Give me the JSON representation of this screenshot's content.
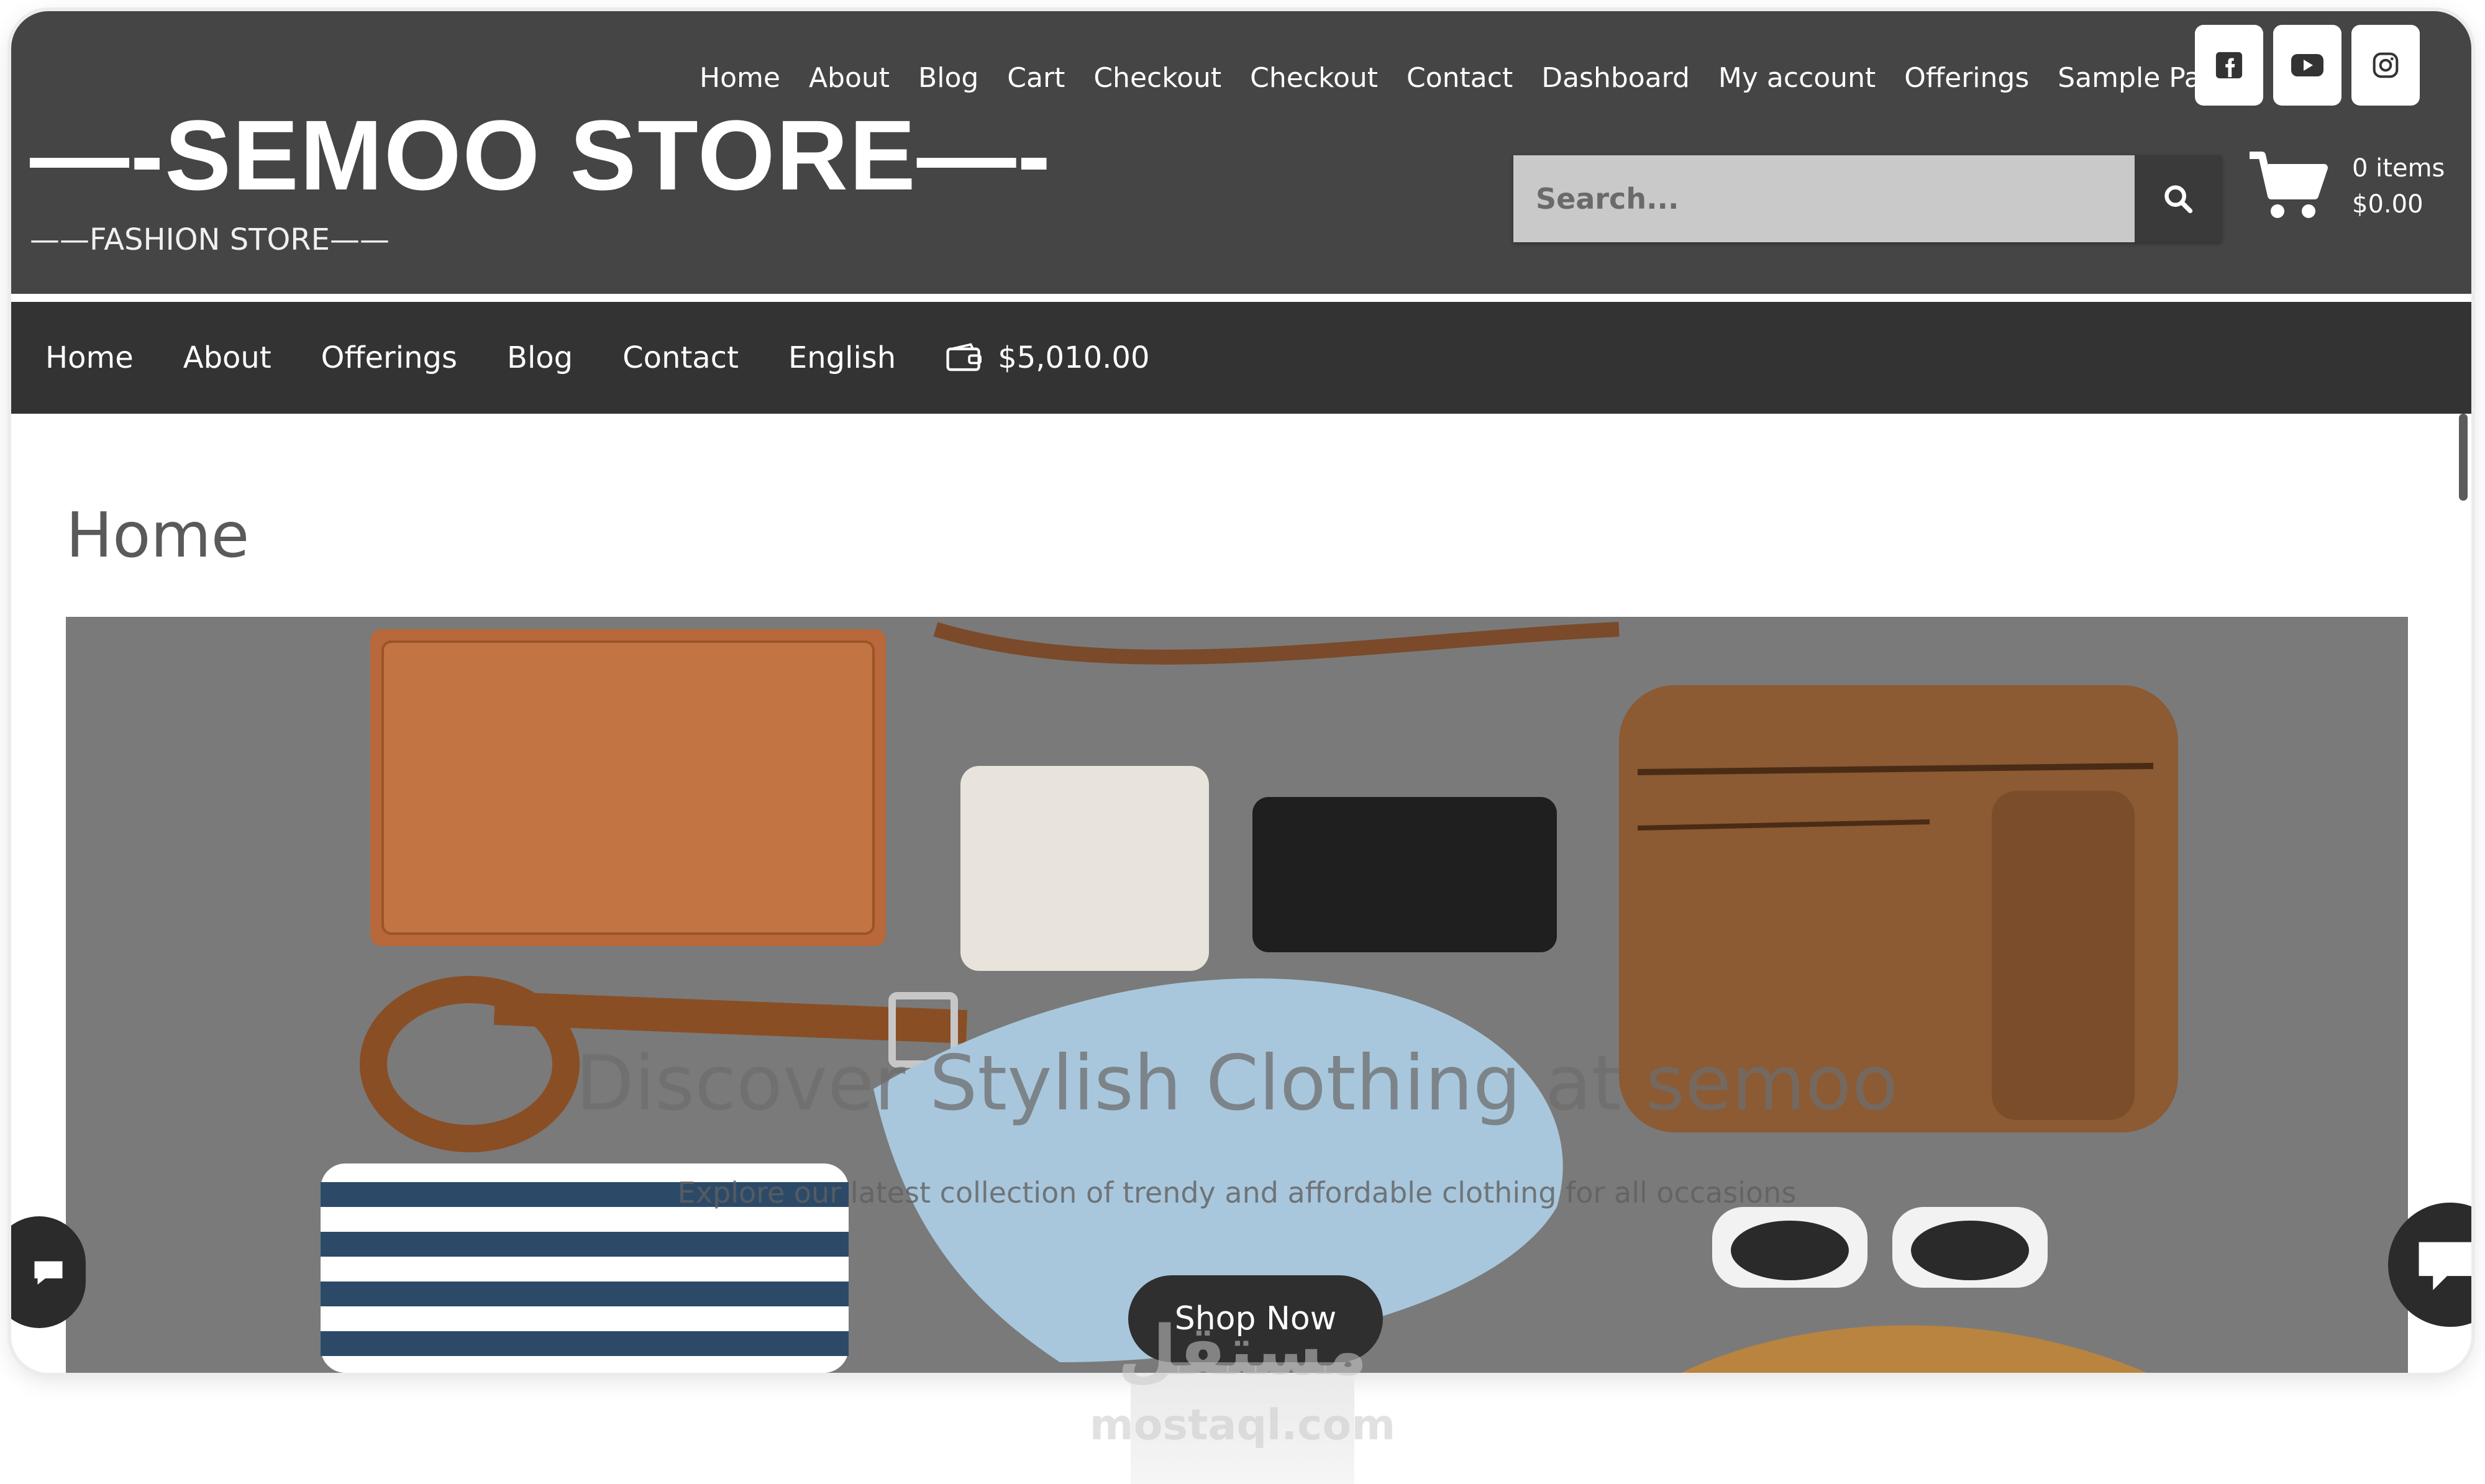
{
  "header": {
    "top_nav": [
      "Home",
      "About",
      "Blog",
      "Cart",
      "Checkout",
      "Checkout",
      "Contact",
      "Dashboard",
      "My account",
      "Offerings",
      "Sample Page"
    ],
    "site_title": "—-SEMOO STORE—-",
    "tagline": "——FASHION STORE——",
    "social_icons": [
      "facebook-icon",
      "youtube-icon",
      "instagram-icon"
    ],
    "search": {
      "placeholder": "Search...",
      "icon": "search-icon"
    },
    "cart": {
      "items": "0 items",
      "total": "$0.00",
      "icon": "cart-icon"
    }
  },
  "main_nav": {
    "items": [
      "Home",
      "About",
      "Offerings",
      "Blog",
      "Contact",
      "English"
    ],
    "wallet": {
      "icon": "wallet-icon",
      "amount": "$5,010.00"
    }
  },
  "content": {
    "page_title": "Home",
    "hero": {
      "heading": "Discover Stylish Clothing at semoo",
      "subheading": "Explore our latest collection of trendy and affordable clothing for all occasions",
      "button": "Shop Now"
    }
  },
  "chat": {
    "left_icon": "chat-icon",
    "right_icon": "chat-icon"
  },
  "watermark": {
    "arabic": "مستقل",
    "latin": "mostaql.com"
  },
  "colors": {
    "header": "#454545",
    "nav": "#333333",
    "hero_bg": "#7c7c7c",
    "button": "#2f2f2f"
  }
}
